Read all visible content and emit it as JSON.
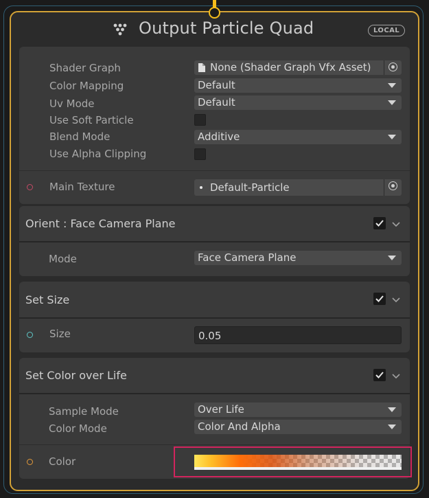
{
  "node": {
    "title": "Output Particle Quad",
    "badge": "LOCAL"
  },
  "output_block": {
    "shader_graph_label": "Shader Graph",
    "shader_graph_value": "None (Shader Graph Vfx Asset)",
    "color_mapping_label": "Color Mapping",
    "color_mapping_value": "Default",
    "uv_mode_label": "Uv Mode",
    "uv_mode_value": "Default",
    "use_soft_particle_label": "Use Soft Particle",
    "blend_mode_label": "Blend Mode",
    "blend_mode_value": "Additive",
    "use_alpha_clipping_label": "Use Alpha Clipping",
    "main_texture_label": "Main Texture",
    "main_texture_value": "Default-Particle"
  },
  "orient_block": {
    "title": "Orient : Face Camera Plane",
    "mode_label": "Mode",
    "mode_value": "Face Camera Plane"
  },
  "set_size_block": {
    "title": "Set Size",
    "size_label": "Size",
    "size_value": "0.05"
  },
  "color_life_block": {
    "title": "Set Color over Life",
    "sample_mode_label": "Sample Mode",
    "sample_mode_value": "Over Life",
    "color_mode_label": "Color Mode",
    "color_mode_value": "Color And Alpha",
    "color_label": "Color"
  },
  "colors": {
    "node_border": "#d3a236",
    "outer_border": "#2f5e74",
    "highlight": "#d2245d",
    "port": "#f5bd1b"
  }
}
